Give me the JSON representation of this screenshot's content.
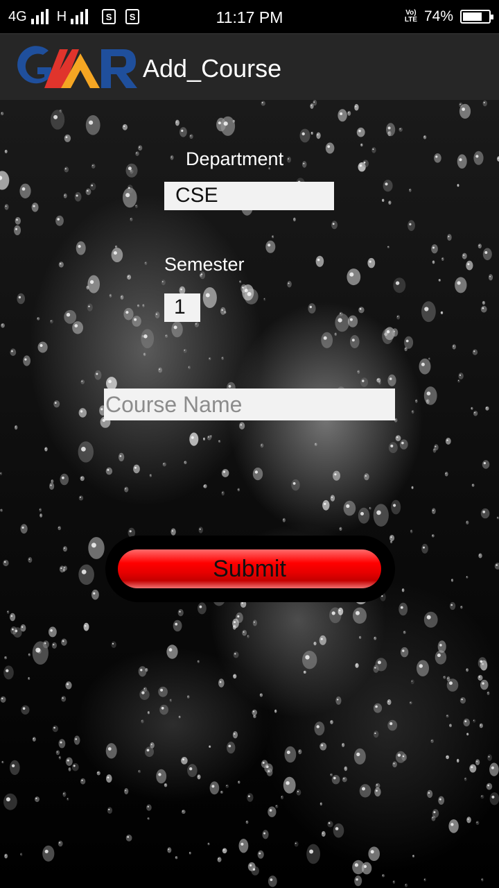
{
  "status_bar": {
    "network_1": "4G",
    "network_2": "H",
    "sim_1": "S",
    "sim_2": "S",
    "time": "11:17 PM",
    "volte_top": "Vo)",
    "volte_bottom": "LTE",
    "battery_percent_label": "74%",
    "battery_level": 0.74,
    "icons": [
      "signal-icon",
      "sim-icon",
      "volte-icon",
      "battery-icon"
    ]
  },
  "app_bar": {
    "logo": "GMR",
    "title": "Add_Course",
    "colors": {
      "background": "#262626",
      "logo_blue": "#1f4f9c",
      "logo_red": "#e0342c",
      "logo_orange": "#f5a623"
    }
  },
  "form": {
    "department_label": "Department",
    "department_value": "CSE",
    "semester_label": "Semester",
    "semester_value": "1",
    "course_name_placeholder": "Course Name",
    "course_name_value": "",
    "submit_label": "Submit",
    "colors": {
      "submit": "#ff0000",
      "field_bg": "#f2f2f2"
    }
  }
}
